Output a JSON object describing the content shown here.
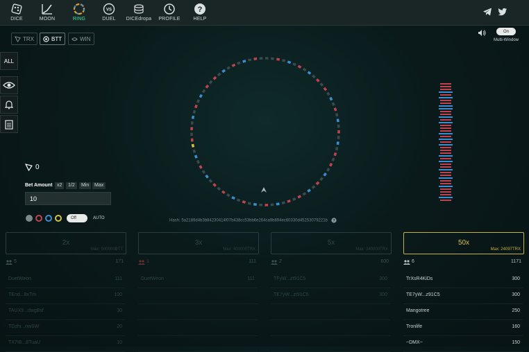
{
  "nav": [
    {
      "label": "DICE",
      "icon": "dice-icon"
    },
    {
      "label": "MOON",
      "icon": "moon-chart-icon"
    },
    {
      "label": "RING",
      "icon": "ring-icon",
      "active": true
    },
    {
      "label": "DUEL",
      "icon": "duel-icon"
    },
    {
      "label": "DICEdropa",
      "icon": "coins-icon"
    },
    {
      "label": "PROFILE",
      "icon": "history-clock-icon"
    },
    {
      "label": "HELP",
      "icon": "help-icon"
    }
  ],
  "currencies": [
    {
      "label": "TRX",
      "active": false
    },
    {
      "label": "BTT",
      "active": true
    },
    {
      "label": "WIN",
      "active": false
    }
  ],
  "side_tabs": {
    "all": "ALL"
  },
  "multi_window": {
    "toggle": "On",
    "label": "Multi-Window"
  },
  "balance": "0",
  "bet": {
    "label": "Bet Amount",
    "chips": [
      "x2",
      "1/2",
      "Min",
      "Max"
    ],
    "value": "10"
  },
  "auto": {
    "toggle": "Off",
    "label": "AUTO"
  },
  "hash": "Hash: 5a2189d4b3b84230414f07b438cc53bb6e264ca9b894ec60330d45253079221b",
  "ring": {
    "segments": "ggrgbgrgbgrgrgbgrgbgrgbgrgrgbgrgbgrgrgbgrgbgrgbgrgrgbgrgbgyrgrgbgrgbgrgrgbgrgbgrg",
    "colors": {
      "g": "#3a4a4c",
      "r": "#c0444f",
      "b": "#3b8fd0",
      "y": "#d6c14a"
    }
  },
  "history_colors": [
    "r",
    "r",
    "r",
    "b",
    "r",
    "b",
    "r",
    "r",
    "b",
    "b",
    "r",
    "r",
    "b",
    "r",
    "b",
    "r",
    "r",
    "r",
    "b",
    "r",
    "b",
    "r",
    "b",
    "r",
    "r",
    "r",
    "b",
    "r",
    "b",
    "r",
    "r",
    "b",
    "r",
    "r",
    "b",
    "r",
    "r",
    "b",
    "r",
    "r",
    "r",
    "b",
    "r"
  ],
  "columns": [
    {
      "mult": "2x",
      "max": "Max: 500000BTT",
      "count": "5",
      "total": "171",
      "gold": false,
      "rows": [
        [
          "DuetWeon",
          "111"
        ],
        [
          "TEnd...8xTm",
          "100"
        ],
        [
          "TAUX9...dwgBsf",
          "30"
        ],
        [
          "TDzhi...nwSW",
          "20"
        ],
        [
          "TX7IB...8TuaU",
          "10"
        ]
      ]
    },
    {
      "mult": "3x",
      "max": "Max: 400000TRX",
      "count": "1",
      "total": "111",
      "gold": false,
      "rows": [
        [
          "DuetWeon",
          "111"
        ]
      ]
    },
    {
      "mult": "5x",
      "max": "Max: 240000TRX",
      "count": "2",
      "total": "600",
      "gold": false,
      "rows": [
        [
          "TFyW...zt91C5",
          "300"
        ],
        [
          "TE7yW...zt91C5",
          "300"
        ]
      ]
    },
    {
      "mult": "50x",
      "max": "Max: 24097TRX",
      "count": "6",
      "total": "1171",
      "gold": true,
      "rows": [
        [
          "TrXsR4KiDs",
          "300"
        ],
        [
          "TE7yW...z91C5",
          "300"
        ],
        [
          "Mangotree",
          "250"
        ],
        [
          "Tronlife",
          "160"
        ],
        [
          "~DMX~",
          "150"
        ]
      ]
    }
  ]
}
